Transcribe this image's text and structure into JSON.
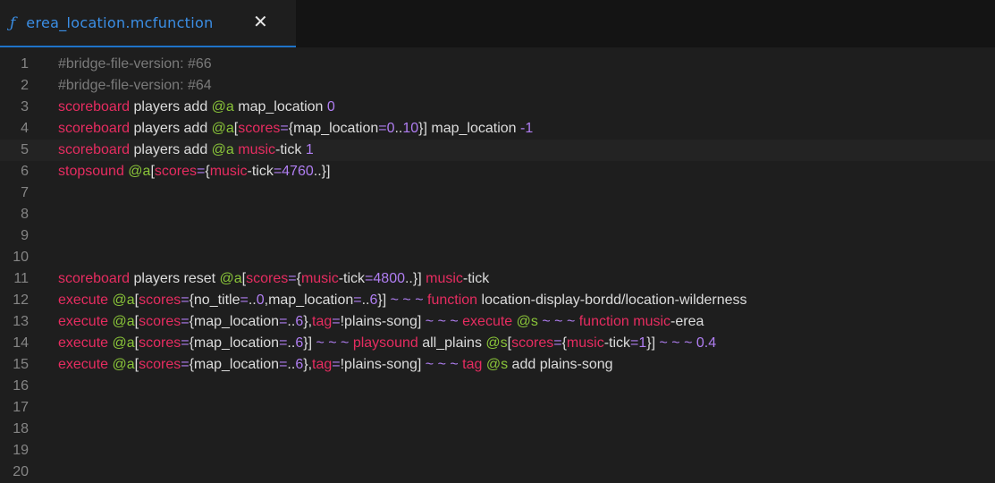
{
  "tab": {
    "icon": "mcfunction-file-icon",
    "icon_glyph": "ƒ",
    "title": "erea_location.mcfunction",
    "close_glyph": "✕"
  },
  "current_line": 5,
  "lines": [
    {
      "n": "1",
      "tokens": [
        [
          "cmt",
          "#bridge-file-version: #66"
        ]
      ]
    },
    {
      "n": "2",
      "tokens": [
        [
          "cmt",
          "#bridge-file-version: #64"
        ]
      ]
    },
    {
      "n": "3",
      "tokens": [
        [
          "kw",
          "scoreboard"
        ],
        [
          "txt",
          " players add "
        ],
        [
          "sel",
          "@a"
        ],
        [
          "txt",
          " map_location "
        ],
        [
          "num",
          "0"
        ]
      ]
    },
    {
      "n": "4",
      "tokens": [
        [
          "kw",
          "scoreboard"
        ],
        [
          "txt",
          " players add "
        ],
        [
          "sel",
          "@a"
        ],
        [
          "txt",
          "["
        ],
        [
          "kw",
          "scores"
        ],
        [
          "op",
          "="
        ],
        [
          "txt",
          "{map_location"
        ],
        [
          "op",
          "="
        ],
        [
          "num",
          "0"
        ],
        [
          "txt",
          ".."
        ],
        [
          "num",
          "10"
        ],
        [
          "txt",
          "}] map_location "
        ],
        [
          "num",
          "-1"
        ]
      ]
    },
    {
      "n": "5",
      "tokens": [
        [
          "kw",
          "scoreboard"
        ],
        [
          "txt",
          " players add "
        ],
        [
          "sel",
          "@a"
        ],
        [
          "txt",
          " "
        ],
        [
          "kw",
          "music"
        ],
        [
          "txt",
          "-tick "
        ],
        [
          "num",
          "1"
        ]
      ]
    },
    {
      "n": "6",
      "tokens": [
        [
          "kw",
          "stopsound"
        ],
        [
          "txt",
          " "
        ],
        [
          "sel",
          "@a"
        ],
        [
          "txt",
          "["
        ],
        [
          "kw",
          "scores"
        ],
        [
          "op",
          "="
        ],
        [
          "txt",
          "{"
        ],
        [
          "kw",
          "music"
        ],
        [
          "txt",
          "-tick"
        ],
        [
          "op",
          "="
        ],
        [
          "num",
          "4760"
        ],
        [
          "txt",
          "..}]"
        ]
      ]
    },
    {
      "n": "7",
      "tokens": []
    },
    {
      "n": "8",
      "tokens": []
    },
    {
      "n": "9",
      "tokens": []
    },
    {
      "n": "10",
      "tokens": []
    },
    {
      "n": "11",
      "tokens": [
        [
          "kw",
          "scoreboard"
        ],
        [
          "txt",
          " players reset "
        ],
        [
          "sel",
          "@a"
        ],
        [
          "txt",
          "["
        ],
        [
          "kw",
          "scores"
        ],
        [
          "op",
          "="
        ],
        [
          "txt",
          "{"
        ],
        [
          "kw",
          "music"
        ],
        [
          "txt",
          "-tick"
        ],
        [
          "op",
          "="
        ],
        [
          "num",
          "4800"
        ],
        [
          "txt",
          "..}] "
        ],
        [
          "kw",
          "music"
        ],
        [
          "txt",
          "-tick"
        ]
      ]
    },
    {
      "n": "12",
      "tokens": [
        [
          "kw",
          "execute"
        ],
        [
          "txt",
          " "
        ],
        [
          "sel",
          "@a"
        ],
        [
          "txt",
          "["
        ],
        [
          "kw",
          "scores"
        ],
        [
          "op",
          "="
        ],
        [
          "txt",
          "{no_title"
        ],
        [
          "op",
          "="
        ],
        [
          "txt",
          ".."
        ],
        [
          "num",
          "0"
        ],
        [
          "txt",
          ",map_location"
        ],
        [
          "op",
          "="
        ],
        [
          "txt",
          ".."
        ],
        [
          "num",
          "6"
        ],
        [
          "txt",
          "}] "
        ],
        [
          "op",
          "~ ~ ~"
        ],
        [
          "txt",
          " "
        ],
        [
          "kw",
          "function"
        ],
        [
          "txt",
          " location-display-bordd/location-wilderness"
        ]
      ]
    },
    {
      "n": "13",
      "tokens": [
        [
          "kw",
          "execute"
        ],
        [
          "txt",
          " "
        ],
        [
          "sel",
          "@a"
        ],
        [
          "txt",
          "["
        ],
        [
          "kw",
          "scores"
        ],
        [
          "op",
          "="
        ],
        [
          "txt",
          "{map_location"
        ],
        [
          "op",
          "="
        ],
        [
          "txt",
          ".."
        ],
        [
          "num",
          "6"
        ],
        [
          "txt",
          "},"
        ],
        [
          "kw",
          "tag"
        ],
        [
          "op",
          "="
        ],
        [
          "txt",
          "!plains-song] "
        ],
        [
          "op",
          "~ ~ ~"
        ],
        [
          "txt",
          " "
        ],
        [
          "kw",
          "execute"
        ],
        [
          "txt",
          " "
        ],
        [
          "sel",
          "@s"
        ],
        [
          "txt",
          " "
        ],
        [
          "op",
          "~ ~ ~"
        ],
        [
          "txt",
          " "
        ],
        [
          "kw",
          "function"
        ],
        [
          "txt",
          " "
        ],
        [
          "kw",
          "music"
        ],
        [
          "txt",
          "-erea"
        ]
      ]
    },
    {
      "n": "14",
      "tokens": [
        [
          "kw",
          "execute"
        ],
        [
          "txt",
          " "
        ],
        [
          "sel",
          "@a"
        ],
        [
          "txt",
          "["
        ],
        [
          "kw",
          "scores"
        ],
        [
          "op",
          "="
        ],
        [
          "txt",
          "{map_location"
        ],
        [
          "op",
          "="
        ],
        [
          "txt",
          ".."
        ],
        [
          "num",
          "6"
        ],
        [
          "txt",
          "}] "
        ],
        [
          "op",
          "~ ~ ~"
        ],
        [
          "txt",
          " "
        ],
        [
          "kw",
          "playsound"
        ],
        [
          "txt",
          " all_plains "
        ],
        [
          "sel",
          "@s"
        ],
        [
          "txt",
          "["
        ],
        [
          "kw",
          "scores"
        ],
        [
          "op",
          "="
        ],
        [
          "txt",
          "{"
        ],
        [
          "kw",
          "music"
        ],
        [
          "txt",
          "-tick"
        ],
        [
          "op",
          "="
        ],
        [
          "num",
          "1"
        ],
        [
          "txt",
          "}] "
        ],
        [
          "op",
          "~ ~ ~"
        ],
        [
          "txt",
          " "
        ],
        [
          "num",
          "0.4"
        ]
      ]
    },
    {
      "n": "15",
      "tokens": [
        [
          "kw",
          "execute"
        ],
        [
          "txt",
          " "
        ],
        [
          "sel",
          "@a"
        ],
        [
          "txt",
          "["
        ],
        [
          "kw",
          "scores"
        ],
        [
          "op",
          "="
        ],
        [
          "txt",
          "{map_location"
        ],
        [
          "op",
          "="
        ],
        [
          "txt",
          ".."
        ],
        [
          "num",
          "6"
        ],
        [
          "txt",
          "},"
        ],
        [
          "kw",
          "tag"
        ],
        [
          "op",
          "="
        ],
        [
          "txt",
          "!plains-song] "
        ],
        [
          "op",
          "~ ~ ~"
        ],
        [
          "txt",
          " "
        ],
        [
          "kw",
          "tag"
        ],
        [
          "txt",
          " "
        ],
        [
          "sel",
          "@s"
        ],
        [
          "txt",
          " add plains-song"
        ]
      ]
    },
    {
      "n": "16",
      "tokens": []
    },
    {
      "n": "17",
      "tokens": []
    },
    {
      "n": "18",
      "tokens": []
    },
    {
      "n": "19",
      "tokens": []
    },
    {
      "n": "20",
      "tokens": []
    }
  ]
}
